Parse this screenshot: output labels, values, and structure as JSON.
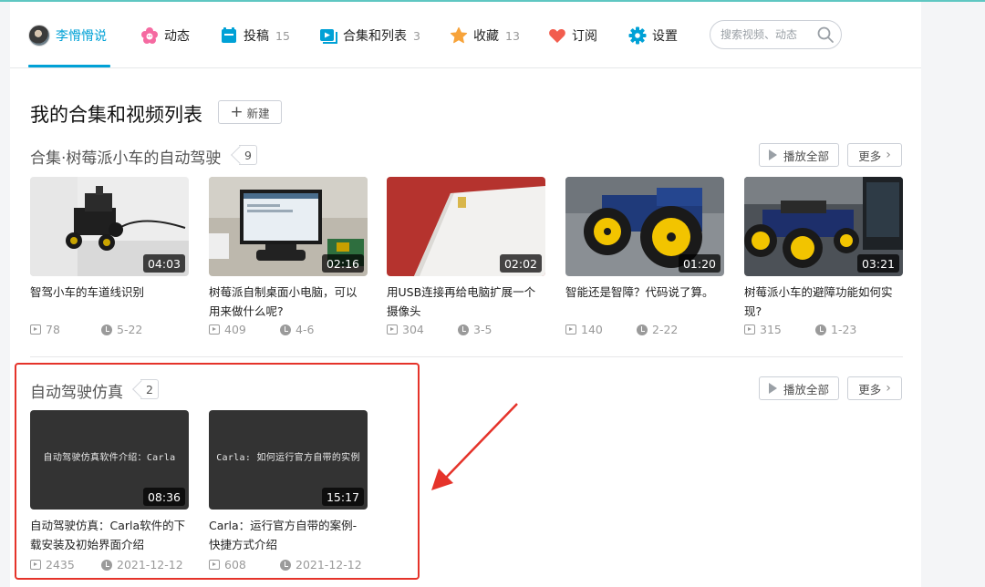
{
  "colors": {
    "accent": "#00a1d6",
    "highlight": "#e5332a"
  },
  "nav": {
    "user": {
      "name": "李愲愲说",
      "icon": "avatar"
    },
    "items": [
      {
        "label": "动态",
        "count": "",
        "icon": "flower-icon"
      },
      {
        "label": "投稿",
        "count": "15",
        "icon": "upload-icon"
      },
      {
        "label": "合集和列表",
        "count": "3",
        "icon": "playlist-icon"
      },
      {
        "label": "收藏",
        "count": "13",
        "icon": "star-icon"
      },
      {
        "label": "订阅",
        "count": "",
        "icon": "heart-icon"
      },
      {
        "label": "设置",
        "count": "",
        "icon": "gear-icon"
      }
    ],
    "search_placeholder": "搜索视频、动态"
  },
  "header": {
    "title": "我的合集和视频列表",
    "new_label": "新建"
  },
  "collections": [
    {
      "title": "合集·树莓派小车的自动驾驶",
      "count": "9",
      "play_all": "播放全部",
      "more": "更多",
      "videos": [
        {
          "title": "智驾小车的车道线识别",
          "duration": "04:03",
          "plays": "78",
          "date": "5-22"
        },
        {
          "title": "树莓派自制桌面小电脑，可以用来做什么呢?",
          "duration": "02:16",
          "plays": "409",
          "date": "4-6"
        },
        {
          "title": "用USB连接再给电脑扩展一个摄像头",
          "duration": "02:02",
          "plays": "304",
          "date": "3-5"
        },
        {
          "title": "智能还是智障？代码说了算。",
          "duration": "01:20",
          "plays": "140",
          "date": "2-22"
        },
        {
          "title": "树莓派小车的避障功能如何实现?",
          "duration": "03:21",
          "plays": "315",
          "date": "1-23"
        }
      ]
    },
    {
      "title": "自动驾驶仿真",
      "count": "2",
      "play_all": "播放全部",
      "more": "更多",
      "videos": [
        {
          "title": "自动驾驶仿真：Carla软件的下载安装及初始界面介绍",
          "duration": "08:36",
          "plays": "2435",
          "date": "2021-12-12",
          "thumb_text": "自动驾驶仿真软件介绍：Carla"
        },
        {
          "title": "Carla：运行官方自带的案例-快捷方式介绍",
          "duration": "15:17",
          "plays": "608",
          "date": "2021-12-12",
          "thumb_text": "Carla: 如何运行官方自带的实例"
        }
      ]
    }
  ]
}
